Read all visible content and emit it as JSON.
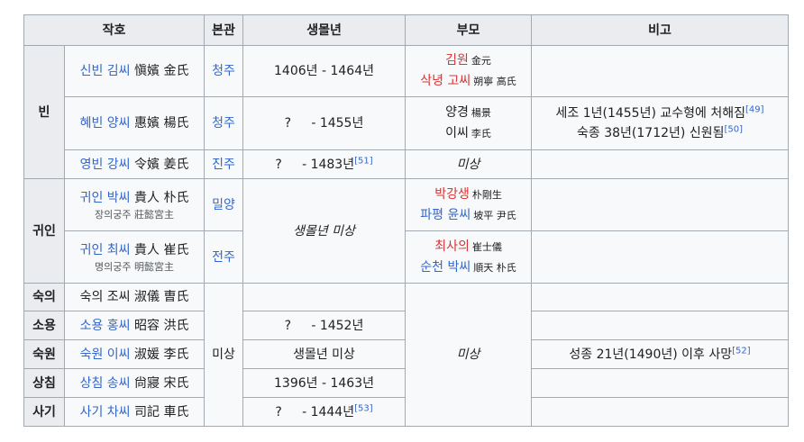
{
  "headers": [
    "작호",
    "본관",
    "생몰년",
    "부모",
    "비고"
  ],
  "groups": {
    "bin": "빈",
    "gwiin": "귀인",
    "sugui": "숙의",
    "soyong": "소용",
    "sugwon": "숙원",
    "sangchim": "상침",
    "sagi": "사기"
  },
  "rows": {
    "r1": {
      "name": "신빈 김씨",
      "hanja": "愼嬪 金氏",
      "bongwan": "청주",
      "dates": "1406년 - 1464년",
      "parent1": "김원",
      "parent1_hanja": "金元",
      "parent2": "삭녕 고씨",
      "parent2_hanja": "朔寧 高氏",
      "note": ""
    },
    "r2": {
      "name": "혜빈 양씨",
      "hanja": "惠嬪 楊氏",
      "bongwan": "청주",
      "dates": "?     - 1455년",
      "parent1": "양경",
      "parent1_hanja": "楊景",
      "parent2": "이씨",
      "parent2_hanja": "李氏",
      "note1": "세조 1년(1455년) 교수형에 처해짐",
      "note1_ref": "[49]",
      "note2": "숙종 38년(1712년) 신원됨",
      "note2_ref": "[50]"
    },
    "r3": {
      "name": "영빈 강씨",
      "hanja": "令嬪 姜氏",
      "bongwan": "진주",
      "dates": "?     - 1483년",
      "dates_ref": "[51]",
      "parents": "미상",
      "note": ""
    },
    "r4": {
      "name": "귀인 박씨",
      "hanja": "貴人 朴氏",
      "sub": "장의궁주",
      "sub_hanja": "莊懿宮主",
      "bongwan": "밀양",
      "parent1": "박강생",
      "parent1_hanja": "朴剛生",
      "parent2": "파평 윤씨",
      "parent2_hanja": "坡平 尹氏",
      "note": ""
    },
    "r5": {
      "name": "귀인 최씨",
      "hanja": "貴人 崔氏",
      "sub": "명의궁주",
      "sub_hanja": "明懿宮主",
      "bongwan": "전주",
      "parent1": "최사의",
      "parent1_hanja": "崔士儀",
      "parent2": "순천 박씨",
      "parent2_hanja": "順天 朴氏",
      "note": ""
    },
    "gwiin_dates": "생몰년 미상",
    "r6": {
      "name": "숙의 조씨",
      "hanja": "淑儀 曺氏"
    },
    "r7": {
      "name": "소용 홍씨",
      "hanja": "昭容 洪氏",
      "dates": "?     - 1452년"
    },
    "r8": {
      "name": "숙원 이씨",
      "hanja": "淑媛 李氏",
      "dates": "생몰년 미상",
      "note": "성종 21년(1490년) 이후 사망",
      "note_ref": "[52]"
    },
    "r9": {
      "name": "상침 송씨",
      "hanja": "尙寢 宋氏",
      "dates": "1396년 - 1463년"
    },
    "r10": {
      "name": "사기 차씨",
      "hanja": "司記 車氏",
      "dates": "?     - 1444년",
      "dates_ref": "[53]"
    },
    "lower_bongwan": "미상",
    "lower_parents": "미상"
  }
}
